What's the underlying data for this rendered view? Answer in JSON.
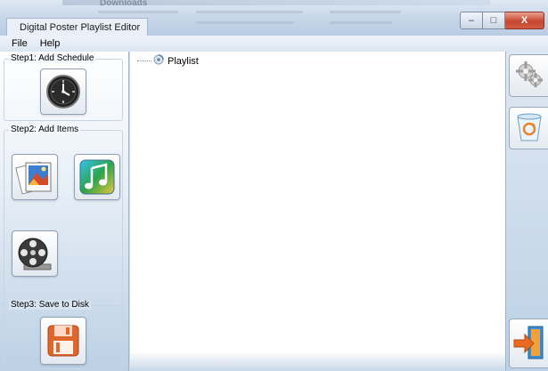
{
  "window": {
    "title": "Digital Poster Playlist Editor",
    "controls": {
      "minimize": "–",
      "maximize": "□",
      "close": "X"
    }
  },
  "background": {
    "downloads_label": "Downloads"
  },
  "menu": {
    "items": [
      {
        "label": "File"
      },
      {
        "label": "Help"
      }
    ]
  },
  "left_panel": {
    "step1": {
      "label": "Step1: Add Schedule",
      "icon": "clock-icon"
    },
    "step2": {
      "label": "Step2: Add Items",
      "icons": [
        "image-icon",
        "music-note-icon",
        "film-reel-icon"
      ]
    },
    "step3": {
      "label": "Step3: Save to Disk",
      "icon": "floppy-disk-icon"
    }
  },
  "tree": {
    "root": {
      "label": "Playlist",
      "icon": "playlist-icon"
    }
  },
  "right_panel": {
    "buttons": [
      "gears-icon",
      "recycle-bin-icon",
      "exit-door-icon"
    ]
  },
  "colors": {
    "panel_gradient_top": "#ffffff",
    "panel_gradient_bottom": "#bcd0e5",
    "floppy_orange": "#e0672b",
    "close_red": "#c8452e"
  }
}
